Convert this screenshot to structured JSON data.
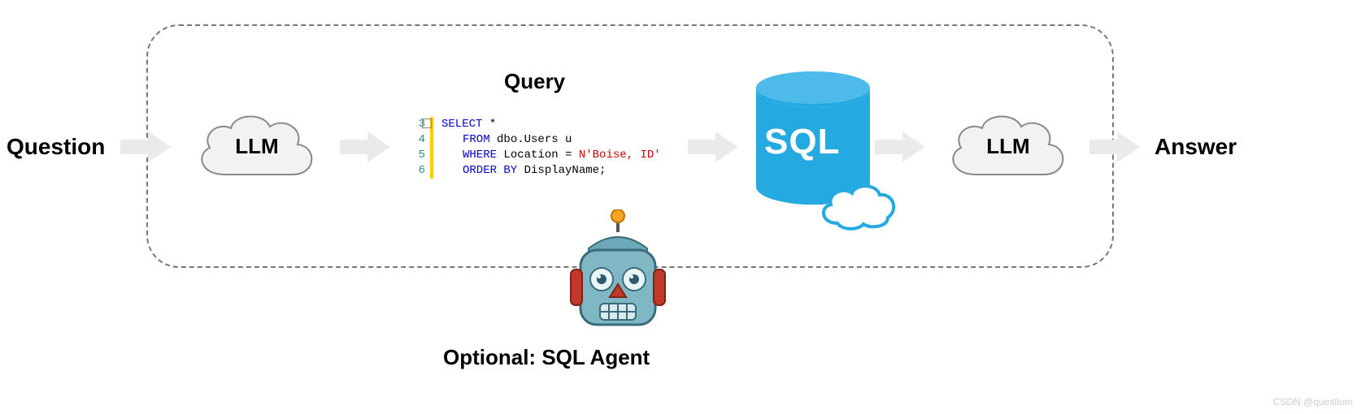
{
  "labels": {
    "question": "Question",
    "answer": "Answer",
    "query": "Query",
    "agent": "Optional: SQL Agent",
    "llm1": "LLM",
    "llm2": "LLM",
    "db": "SQL"
  },
  "code": {
    "line_numbers": [
      "3",
      "4",
      "5",
      "6"
    ],
    "lines": {
      "l1": {
        "kw": "SELECT",
        "rest": " *"
      },
      "l2": {
        "kw": "FROM",
        "rest": " dbo.Users u"
      },
      "l3": {
        "kw": "WHERE",
        "mid": " Location = ",
        "str": "N'Boise, ID'"
      },
      "l4": {
        "kw": "ORDER BY",
        "rest": " DisplayName;"
      }
    }
  },
  "footer": "CSDN @questiom"
}
